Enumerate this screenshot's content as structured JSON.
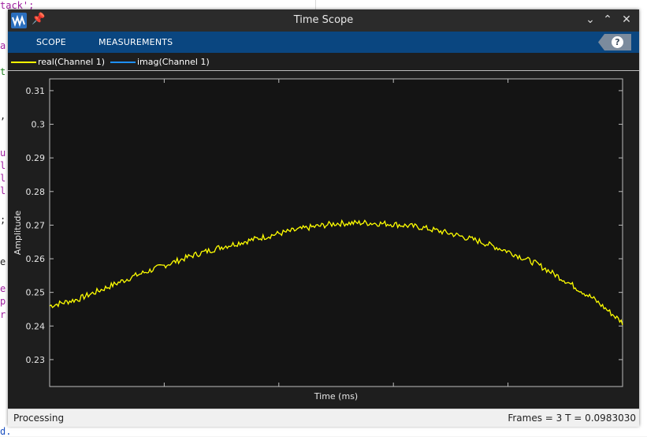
{
  "background_editor": {
    "lines": [
      {
        "text": "tack';",
        "color": "#a020a0"
      },
      {
        "text": "a",
        "color": "#a020a0"
      },
      {
        "text": "t",
        "color": "#208020"
      },
      {
        "text": ",",
        "color": "#222222"
      },
      {
        "text": "u",
        "color": "#a020a0"
      },
      {
        "text": "l",
        "color": "#a020a0"
      },
      {
        "text": "l",
        "color": "#a020a0"
      },
      {
        "text": "l",
        "color": "#a020a0"
      },
      {
        "text": ";",
        "color": "#222222"
      },
      {
        "text": "e",
        "color": "#222222"
      },
      {
        "text": "e",
        "color": "#a020a0"
      },
      {
        "text": "p",
        "color": "#a020a0"
      },
      {
        "text": "r",
        "color": "#a020a0"
      }
    ],
    "bottom_text": "d."
  },
  "window": {
    "title": "Time Scope",
    "pin_icon": "pin-icon",
    "app_icon": "scope-app-icon",
    "controls": {
      "minimize": "⌄",
      "maximize": "⌃",
      "close": "✕"
    }
  },
  "toolstrip": {
    "tabs": [
      "SCOPE",
      "MEASUREMENTS"
    ],
    "help_label": "?"
  },
  "legend": [
    {
      "label": "real(Channel 1)",
      "color": "#ffff00"
    },
    {
      "label": "imag(Channel 1)",
      "color": "#1e90ff"
    }
  ],
  "colors": {
    "plot_background": "#141414",
    "grid": "#3a3a3a",
    "trace": "#ffff00",
    "toolstrip": "#0a4680"
  },
  "status": {
    "left": "Processing",
    "right": "Frames = 3  T = 0.0983030"
  },
  "chart_data": {
    "type": "line",
    "title": "",
    "xlabel": "Time (ms)",
    "ylabel": "Amplitude",
    "ylim": [
      0.222,
      0.3135
    ],
    "yticks": [
      0.23,
      0.24,
      0.25,
      0.26,
      0.27,
      0.28,
      0.29,
      0.3,
      0.31
    ],
    "ytick_labels": [
      "0.23",
      "0.24",
      "0.25",
      "0.26",
      "0.27",
      "0.28",
      "0.29",
      "0.3",
      "0.31"
    ],
    "xlim": [
      0,
      100
    ],
    "xtick_labels_shown": false,
    "grid": false,
    "series": [
      {
        "name": "real(Channel 1)",
        "x": [
          0,
          5,
          10,
          15,
          20,
          25,
          30,
          35,
          40,
          45,
          50,
          55,
          60,
          65,
          70,
          75,
          80,
          85,
          90,
          95,
          100
        ],
        "values": [
          0.246,
          0.248,
          0.2515,
          0.255,
          0.258,
          0.261,
          0.2635,
          0.2655,
          0.2675,
          0.2692,
          0.2705,
          0.2707,
          0.2703,
          0.2693,
          0.2675,
          0.2652,
          0.2622,
          0.2585,
          0.2535,
          0.248,
          0.241
        ]
      }
    ]
  }
}
